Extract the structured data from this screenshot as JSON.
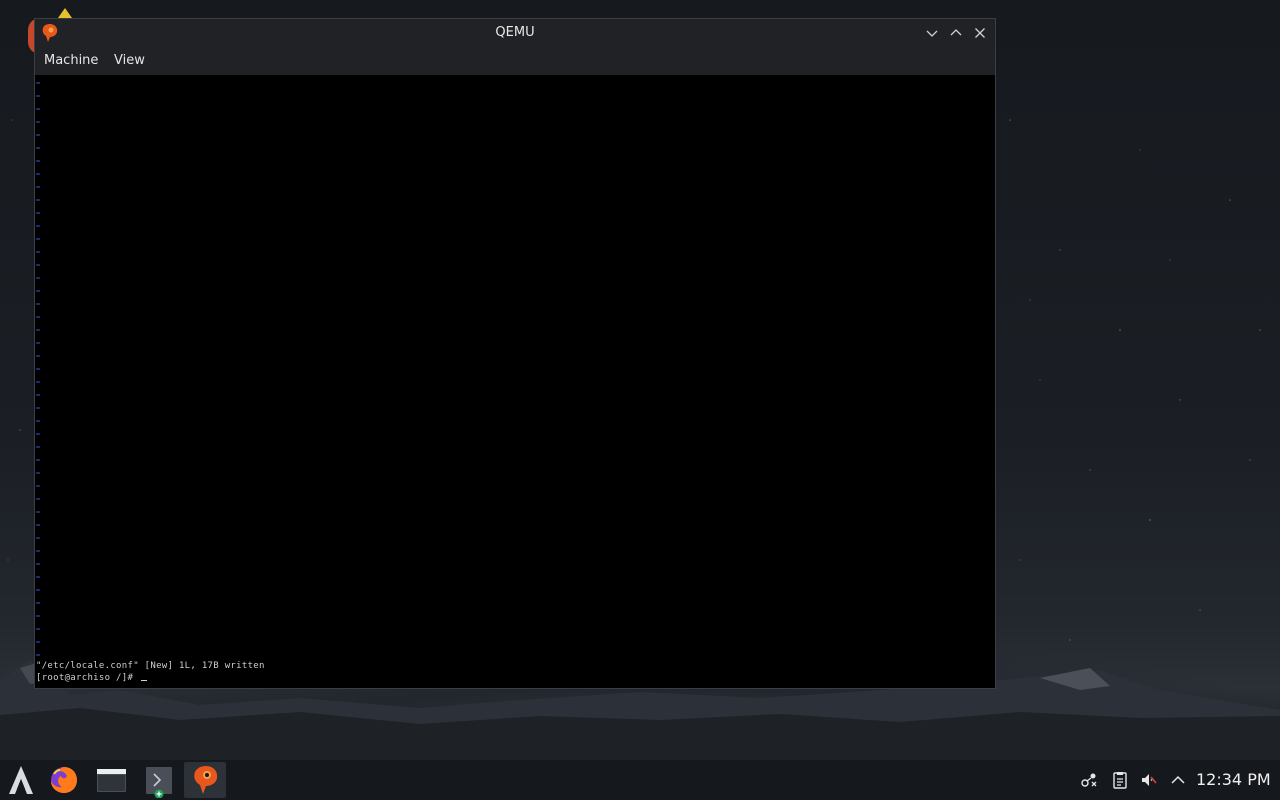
{
  "window": {
    "title": "QEMU",
    "menu": [
      "Machine",
      "View"
    ],
    "controls": [
      "minimize-icon",
      "maximize-icon",
      "close-icon"
    ]
  },
  "console": {
    "lines": [
      "\"/etc/locale.conf\" [New] 1L, 17B written",
      "[root@archiso /]# "
    ]
  },
  "taskbar": {
    "apps": [
      "app-launcher-icon",
      "firefox-icon",
      "file-manager-icon",
      "terminal-icon",
      "qemu-icon"
    ],
    "tray": [
      "network-icon",
      "clipboard-icon",
      "volume-muted-icon",
      "chevron-up-icon"
    ],
    "clock": "12:34 PM"
  },
  "colors": {
    "titlebar": "#202226",
    "taskbar": "#15181c",
    "console_bg": "#000000",
    "console_text": "#cfcfcf",
    "qemu_orange": "#e8581c"
  }
}
